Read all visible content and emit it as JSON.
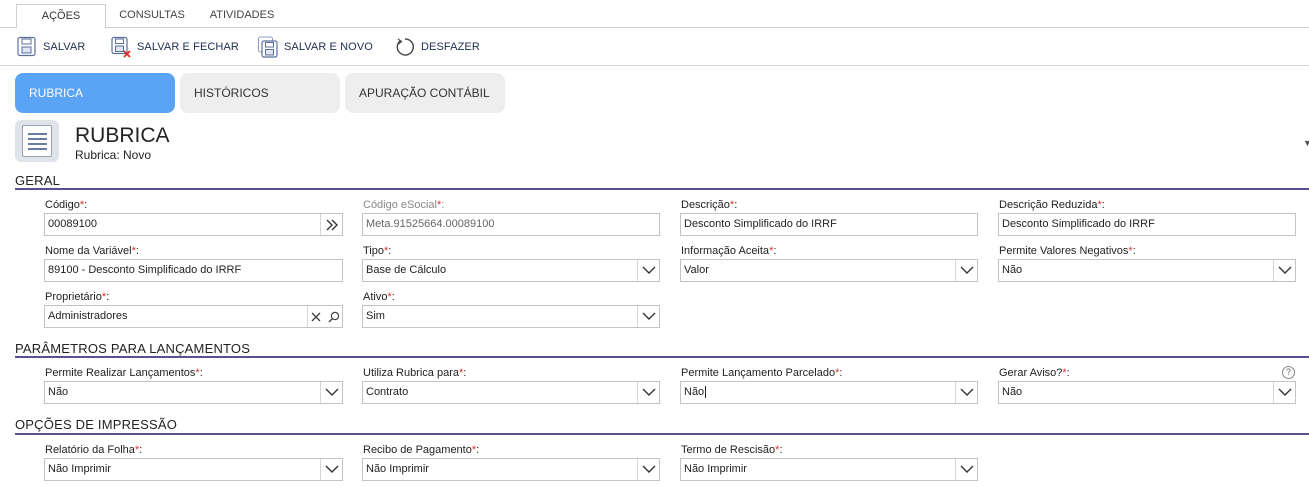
{
  "top_tabs": [
    "AÇÕES",
    "CONSULTAS",
    "ATIVIDADES"
  ],
  "toolbar": {
    "save": "SALVAR",
    "save_close": "SALVAR E FECHAR",
    "save_new": "SALVAR E NOVO",
    "undo": "DESFAZER"
  },
  "section_tabs": [
    "RUBRICA",
    "HISTÓRICOS",
    "APURAÇÃO CONTÁBIL"
  ],
  "header": {
    "title": "RUBRICA",
    "subtitle": "Rubrica: Novo"
  },
  "required_mark": "*",
  "geral": {
    "title": "GERAL",
    "codigo": {
      "label": "Código",
      "value": "00089100"
    },
    "codigo_esocial": {
      "label": "Código eSocial",
      "value": "Meta.91525664.00089100"
    },
    "descricao": {
      "label": "Descrição",
      "value": "Desconto Simplificado do IRRF"
    },
    "descricao_reduzida": {
      "label": "Descrição Reduzida",
      "value": "Desconto Simplificado do IRRF"
    },
    "nome_variavel": {
      "label": "Nome da Variável",
      "value": "89100 - Desconto Simplificado do IRRF"
    },
    "tipo": {
      "label": "Tipo",
      "value": "Base de Cálculo"
    },
    "informacao_aceita": {
      "label": "Informação Aceita",
      "value": "Valor"
    },
    "permite_valores_negativos": {
      "label": "Permite Valores Negativos",
      "value": "Não"
    },
    "proprietario": {
      "label": "Proprietário",
      "value": "Administradores"
    },
    "ativo": {
      "label": "Ativo",
      "value": "Sim"
    }
  },
  "parametros": {
    "title": "PARÂMETROS PARA LANÇAMENTOS",
    "permite_realizar": {
      "label": "Permite Realizar Lançamentos",
      "value": "Não"
    },
    "utiliza_rubrica": {
      "label": "Utiliza Rubrica para",
      "value": "Contrato"
    },
    "permite_parcelado": {
      "label": "Permite Lançamento Parcelado",
      "value": "Não"
    },
    "gerar_aviso": {
      "label": "Gerar Aviso?",
      "value": "Não"
    },
    "help": "?"
  },
  "impressao": {
    "title": "OPÇÕES DE IMPRESSÃO",
    "relatorio_folha": {
      "label": "Relatório da Folha",
      "value": "Não Imprimir"
    },
    "recibo_pagamento": {
      "label": "Recibo de Pagamento",
      "value": "Não Imprimir"
    },
    "termo_rescisao": {
      "label": "Termo de Rescisão",
      "value": "Não Imprimir"
    }
  }
}
